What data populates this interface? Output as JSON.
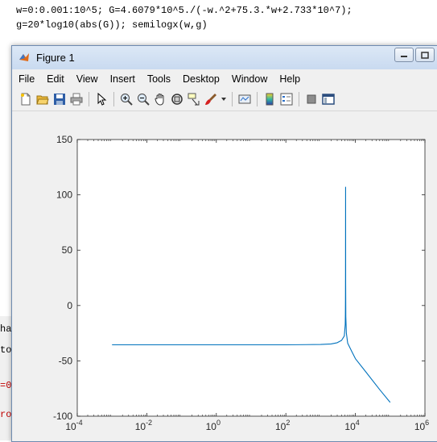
{
  "command_window": {
    "line1": "w=0:0.001:10^5; G=4.6079*10^5./(-w.^2+75.3.*w+2.733*10^7);",
    "line2": "g=20*log10(abs(G)); semilogx(w,g)"
  },
  "left_panel": {
    "line1": "hang",
    "line2": "to M",
    "line3": "=0",
    "line4": "ro"
  },
  "figure": {
    "title": "Figure 1",
    "menu": [
      "File",
      "Edit",
      "View",
      "Insert",
      "Tools",
      "Desktop",
      "Window",
      "Help"
    ],
    "toolbar_icons": [
      "new-figure-icon",
      "open-file-icon",
      "save-icon",
      "print-icon",
      "separator",
      "edit-plot-arrow-icon",
      "separator",
      "zoom-in-icon",
      "zoom-out-icon",
      "pan-hand-icon",
      "rotate-3d-icon",
      "data-cursor-icon",
      "brush-icon",
      "brush-dropdown-icon",
      "separator",
      "link-plot-icon",
      "separator",
      "insert-colorbar-icon",
      "insert-legend-icon",
      "separator",
      "hide-plot-tools-icon",
      "show-plot-tools-icon"
    ]
  },
  "chart_data": {
    "type": "line",
    "xscale": "log",
    "xlim": [
      0.0001,
      1000000
    ],
    "ylim": [
      -100,
      150
    ],
    "xticks": [
      "10^-4",
      "10^-2",
      "10^0",
      "10^2",
      "10^4",
      "10^6"
    ],
    "yticks": [
      150,
      100,
      50,
      0,
      -50,
      -100
    ],
    "series": [
      {
        "color": "#0072bd",
        "x": [
          0.001,
          1,
          100,
          1000,
          2000,
          3000,
          4000,
          4800,
          5100,
          5150,
          5180,
          5200,
          5228,
          5250,
          5300,
          5500,
          6000,
          8000,
          10000,
          20000,
          50000,
          100000
        ],
        "y": [
          -35.5,
          -35.5,
          -35.5,
          -35.2,
          -34.7,
          -33.6,
          -31.5,
          -27.5,
          -17.0,
          -8.0,
          5.0,
          30.0,
          107.0,
          20.0,
          -10.0,
          -25.0,
          -34.0,
          -42.0,
          -48.0,
          -60.0,
          -76.0,
          -87.5
        ]
      }
    ]
  }
}
